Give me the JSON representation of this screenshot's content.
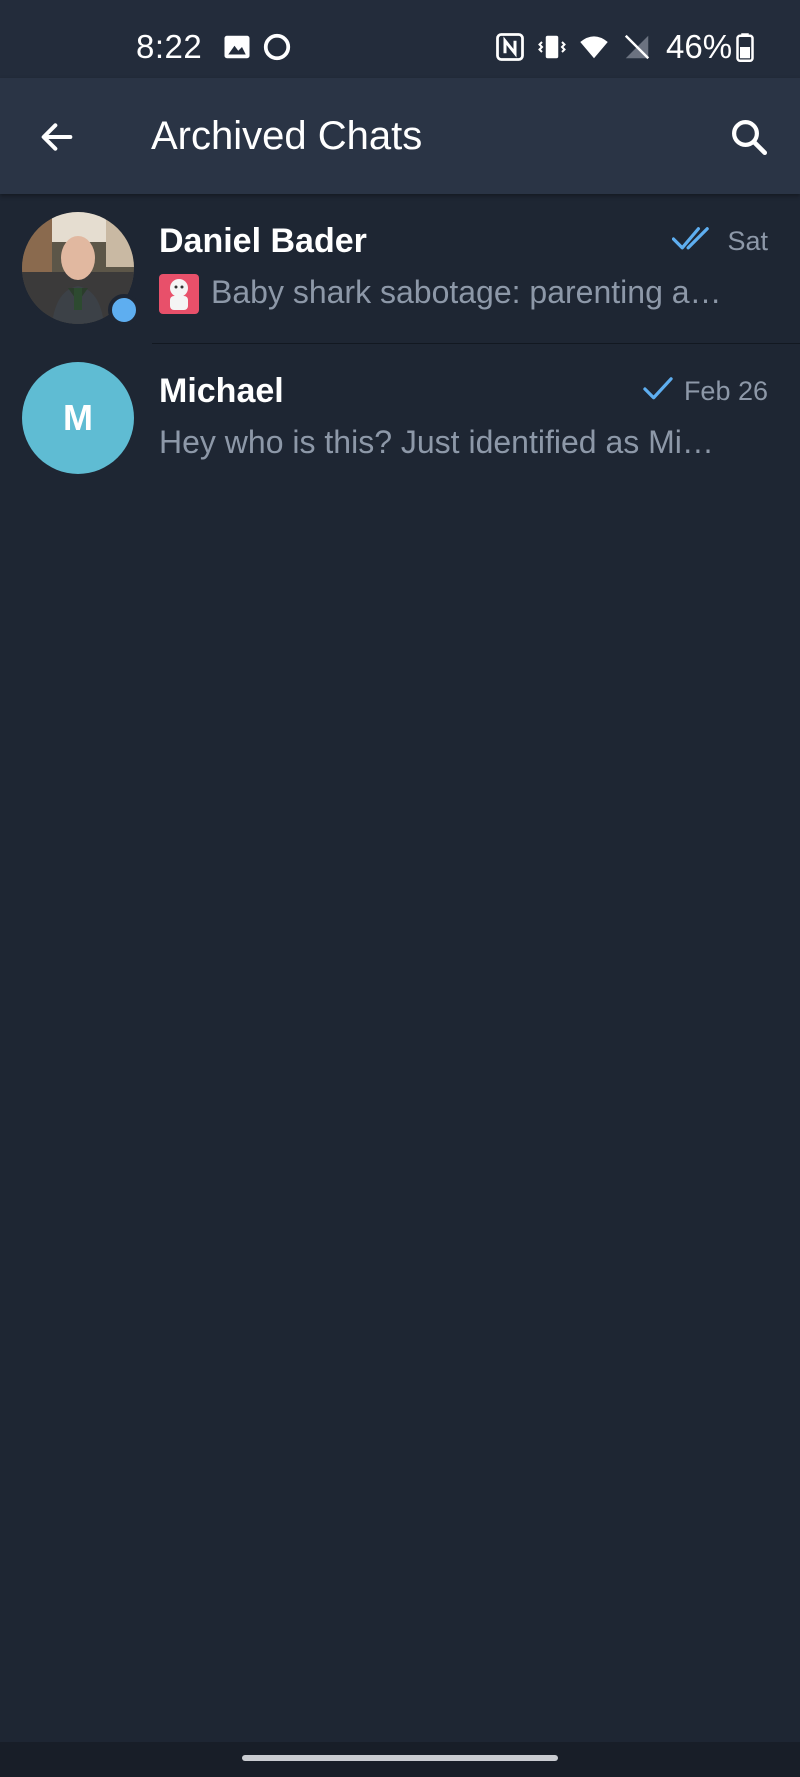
{
  "status_bar": {
    "time": "8:22",
    "battery": "46%",
    "icons": [
      "image-icon",
      "circle-app-icon",
      "nfc-icon",
      "vibrate-icon",
      "wifi-icon",
      "no-signal-icon",
      "battery-icon"
    ]
  },
  "app_bar": {
    "title": "Archived Chats",
    "back_icon": "arrow-left-icon",
    "search_icon": "search-icon"
  },
  "chats": [
    {
      "name": "Daniel Bader",
      "date": "Sat",
      "status": "read",
      "preview": "Baby shark sabotage: parenting a…",
      "online": true,
      "has_media_thumb": true
    },
    {
      "name": "Michael",
      "date": "Feb 26",
      "status": "sent",
      "preview": "Hey who is this? Just identified as Mi…",
      "avatar_letter": "M",
      "avatar_color": "#5fbcd3",
      "online": false,
      "has_media_thumb": false
    }
  ],
  "colors": {
    "background": "#1e2633",
    "app_bar": "#2a3445",
    "accent": "#5eaef0",
    "secondary_text": "#8d98a8"
  }
}
